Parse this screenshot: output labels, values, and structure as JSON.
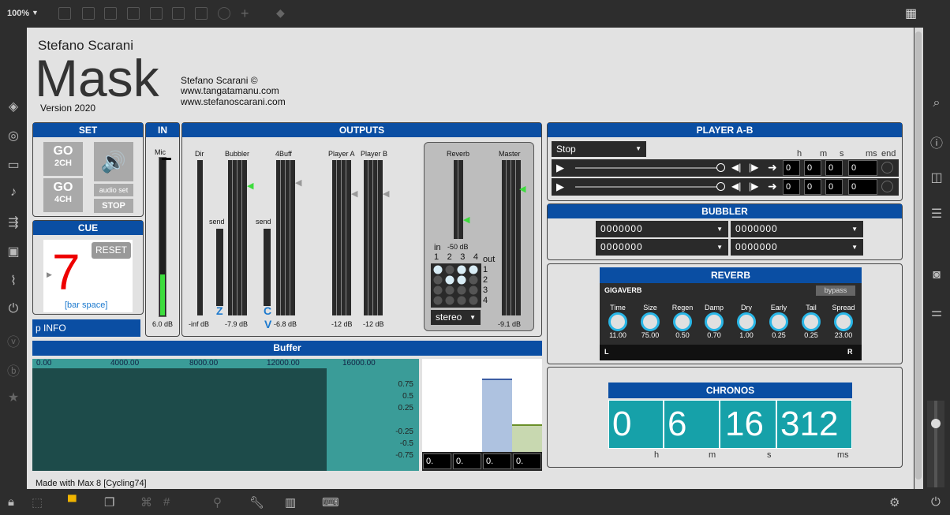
{
  "toolbar": {
    "zoom": "100%",
    "icons": [
      "presentation-icon",
      "comment-icon",
      "speech-icon",
      "box-icon",
      "target-icon",
      "play-icon",
      "slider-icon",
      "dial-icon",
      "plus-icon",
      "bucket-icon",
      "grid-icon"
    ]
  },
  "left_sidebar": [
    "cube-icon",
    "target-icon",
    "bus-icon",
    "note-icon",
    "route-icon",
    "image-icon",
    "clip-icon",
    "plug-icon",
    "v-icon",
    "b-icon",
    "star-icon"
  ],
  "right_sidebar": [
    "search-icon",
    "info-icon",
    "columns-icon",
    "list-icon",
    "camera-icon",
    "sliders-icon"
  ],
  "bottom_bar": [
    "lock-icon",
    "cursor-icon",
    "comment-icon",
    "windows-icon",
    "link-icon",
    "grid-icon",
    "pin-icon",
    "wrench-icon",
    "piano-icon",
    "keyboard-icon",
    "gear-icon",
    "power-icon"
  ],
  "header": {
    "author_top": "Stefano Scarani",
    "title": "Mask",
    "version": "Version 2020",
    "credit_line1": "Stefano Scarani ©",
    "credit_line2": "www.tangatamanu.com",
    "credit_line3": "www.stefanoscarani.com"
  },
  "set": {
    "title": "SET",
    "go2_top": "GO",
    "go2_bottom": "2CH",
    "go4_top": "GO",
    "go4_bottom": "4CH",
    "audio_set": "audio set",
    "stop": "STOP"
  },
  "cue": {
    "title": "CUE",
    "number": "7",
    "reset": "RESET",
    "hint": "[bar space]"
  },
  "pinfo": "p INFO",
  "in": {
    "title": "IN",
    "mic_label": "Mic",
    "mic_db": "6.0 dB",
    "mic_level": 0.26
  },
  "outputs": {
    "title": "OUTPUTS",
    "dir": "Dir",
    "dir_db": "-inf dB",
    "bubbler": "Bubbler",
    "bubbler_db": "-7.9 dB",
    "send1": "send",
    "z": "Z",
    "fourbuff": "4Buff",
    "fourbuff_db": "-6.8 dB",
    "send2": "send",
    "c": "C",
    "v": "V",
    "player_a": "Player A",
    "player_a_db": "-12 dB",
    "player_b": "Player B",
    "player_b_db": "-12 dB",
    "reverb": "Reverb",
    "master": "Master",
    "master_db": "-9.1 dB",
    "in_label": "in",
    "in_db": "-50 dB",
    "matrix_cols": [
      "1",
      "2",
      "3",
      "4"
    ],
    "out_label": "out",
    "matrix_rows": [
      "1",
      "2",
      "3",
      "4"
    ],
    "stereo": "stereo"
  },
  "buffer": {
    "title": "Buffer",
    "ticks": [
      "0.00",
      "4000.00",
      "8000.00",
      "12000.00",
      "16000.00"
    ],
    "yticks": [
      "0.75",
      "0.5",
      "0.25",
      "-0.25",
      "-0.5",
      "-0.75"
    ],
    "bar_values": [
      "0.",
      "0.",
      "0.",
      "0."
    ],
    "footer": "Made with Max 8 [Cycling74]"
  },
  "player": {
    "title": "PLAYER A-B",
    "mode": "Stop",
    "col_h": "h",
    "col_m": "m",
    "col_s": "s",
    "col_ms": "ms",
    "col_end": "end",
    "row1": {
      "h": "0",
      "m": "0",
      "s": "0",
      "ms": "0"
    },
    "row2": {
      "h": "0",
      "m": "0",
      "s": "0",
      "ms": "0"
    }
  },
  "bubbler": {
    "title": "BUBBLER",
    "fields": [
      "0000000",
      "0000000",
      "0000000",
      "0000000"
    ]
  },
  "reverb": {
    "title": "REVERB",
    "plugin": "GIGAVERB",
    "bypass": "bypass",
    "params": [
      {
        "name": "Time",
        "value": "11.00"
      },
      {
        "name": "Size",
        "value": "75.00"
      },
      {
        "name": "Regen",
        "value": "0.50"
      },
      {
        "name": "Damp",
        "value": "0.70"
      },
      {
        "name": "Dry",
        "value": "1.00"
      },
      {
        "name": "Early",
        "value": "0.25"
      },
      {
        "name": "Tail",
        "value": "0.25"
      },
      {
        "name": "Spread",
        "value": "23.00"
      }
    ],
    "left": "L",
    "right": "R"
  },
  "chronos": {
    "title": "CHRONOS",
    "h": "0",
    "m": "6",
    "s": "16",
    "ms": "312",
    "unit_h": "h",
    "unit_m": "m",
    "unit_s": "s",
    "unit_ms": "ms"
  },
  "colors": {
    "accent": "#0a4ea3",
    "teal": "#16a1a9",
    "meter_green": "#3ddc3d"
  }
}
